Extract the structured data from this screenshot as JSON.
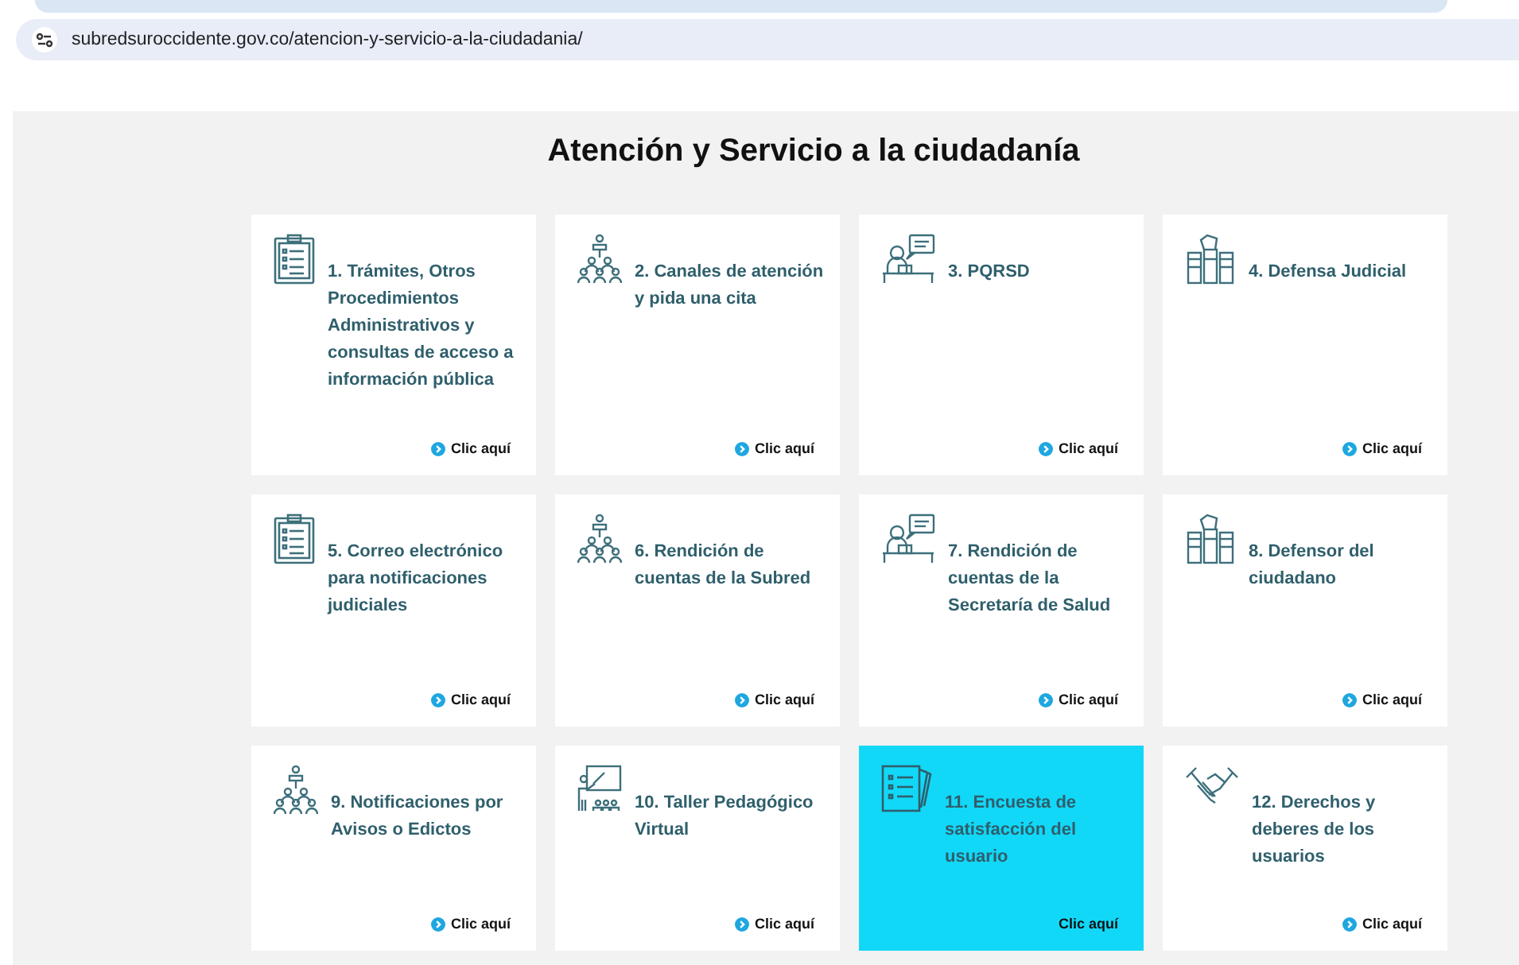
{
  "address_bar": {
    "url": "subredsuroccidente.gov.co/atencion-y-servicio-a-la-ciudadania/"
  },
  "heading": "Atención y Servicio a la ciudadanía",
  "cards": [
    {
      "title": "1. Trámites, Otros Procedimientos Administrativos y consultas de acceso a información pública",
      "kind": "clipboard",
      "link": "Clic aquí",
      "highlighted": false
    },
    {
      "title": "2. Canales de atención y pida una cita",
      "kind": "podium",
      "link": "Clic aquí",
      "highlighted": false
    },
    {
      "title": "3. PQRSD",
      "kind": "desk",
      "link": "Clic aquí",
      "highlighted": false
    },
    {
      "title": "4. Defensa Judicial",
      "kind": "fists",
      "link": "Clic aquí",
      "highlighted": false
    },
    {
      "title": "5. Correo electrónico para notificaciones judiciales",
      "kind": "clipboard",
      "link": "Clic aquí",
      "highlighted": false
    },
    {
      "title": "6. Rendición de cuentas de la Subred",
      "kind": "podium",
      "link": "Clic aquí",
      "highlighted": false
    },
    {
      "title": "7. Rendición de cuentas de la Secretaría de Salud",
      "kind": "desk",
      "link": "Clic aquí",
      "highlighted": false
    },
    {
      "title": "8. Defensor del ciudadano",
      "kind": "fists",
      "link": "Clic aquí",
      "highlighted": false
    },
    {
      "title": "9. Notificaciones por Avisos o Edictos",
      "kind": "podium",
      "link": "Clic aquí",
      "highlighted": false
    },
    {
      "title": "10. Taller Pedagógico Virtual",
      "kind": "teacher",
      "link": "Clic aquí",
      "highlighted": false
    },
    {
      "title": "11. Encuesta de satisfacción del usuario",
      "kind": "survey",
      "link": "Clic aquí",
      "highlighted": true
    },
    {
      "title": "12. Derechos y deberes de los usuarios",
      "kind": "handshake",
      "link": "Clic aquí",
      "highlighted": false
    }
  ]
}
